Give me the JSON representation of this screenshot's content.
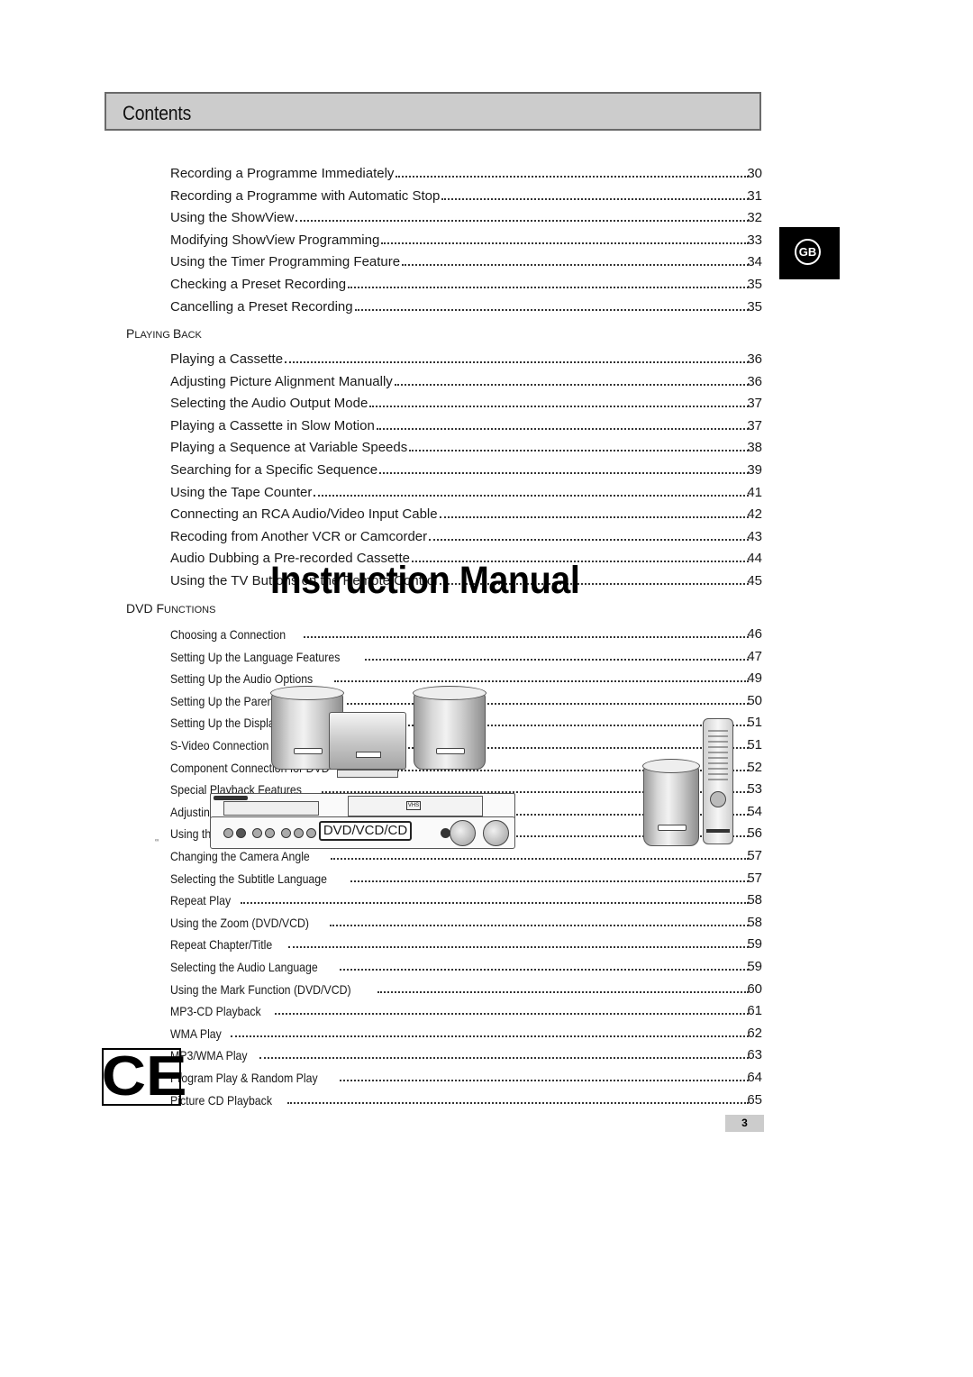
{
  "header": {
    "title": "Contents"
  },
  "language_tab": {
    "label": "GB"
  },
  "watermark": "Instruction Manual",
  "sections": [
    {
      "title": null,
      "items": [
        {
          "label": "Recording a Programme Immediately",
          "page": "30"
        },
        {
          "label": "Recording a Programme with Automatic Stop",
          "page": "31"
        },
        {
          "label": "Using the ShowView",
          "page": "32"
        },
        {
          "label": "Modifying ShowView Programming",
          "page": "33"
        },
        {
          "label": "Using the Timer Programming Feature",
          "page": "34"
        },
        {
          "label": "Checking a Preset Recording",
          "page": "35"
        },
        {
          "label": "Cancelling a Preset Recording",
          "page": "35"
        }
      ]
    },
    {
      "title": {
        "first_big": "P",
        "first_small": "LAYING ",
        "second_big": "B",
        "second_small": "ACK"
      },
      "items": [
        {
          "label": "Playing a Cassette",
          "page": "36"
        },
        {
          "label": "Adjusting Picture Alignment Manually",
          "page": "36"
        },
        {
          "label": "Selecting the Audio Output Mode",
          "page": "37"
        },
        {
          "label": "Playing a Cassette in Slow Motion",
          "page": "37"
        },
        {
          "label": "Playing a Sequence at Variable Speeds",
          "page": "38"
        },
        {
          "label": "Searching for a Specific Sequence",
          "page": "39"
        },
        {
          "label": "Using the Tape Counter",
          "page": "41"
        },
        {
          "label": "Connecting an RCA Audio/Video Input Cable",
          "page": "42"
        },
        {
          "label": "Recoding from Another VCR or Camcorder",
          "page": "43"
        },
        {
          "label": "Audio Dubbing a Pre-recorded Cassette",
          "page": "44"
        },
        {
          "label": "Using the TV Buttons on the Remote Control",
          "page": "45"
        }
      ]
    },
    {
      "title": {
        "first_big": "DVD F",
        "first_small": "UNCTIONS",
        "second_big": "",
        "second_small": ""
      },
      "items": [
        {
          "label": "Choosing a Connection",
          "page": "46"
        },
        {
          "label": "Setting Up the Language Features",
          "page": "47"
        },
        {
          "label": "Setting Up the Audio Options",
          "page": "49"
        },
        {
          "label": "Setting Up the Parental Control",
          "page": "50"
        },
        {
          "label": "Setting Up the Display Options",
          "page": "51"
        },
        {
          "label": "S-Video Connection (DVD/VCR)",
          "page": "51"
        },
        {
          "label": "Component Connection for DVD",
          "page": "52"
        },
        {
          "label": "Special Playback Features",
          "page": "53"
        },
        {
          "label": "Adjusting the Aspect Ratio (EZ VIEW)",
          "page": "54"
        },
        {
          "label": "Using the Display Function (DVD/VCD/CD)",
          "page": "56"
        },
        {
          "label": "Changing the Camera Angle",
          "page": "57"
        },
        {
          "label": "Selecting the Subtitle Language",
          "page": "57"
        },
        {
          "label": "Repeat Play",
          "page": "58"
        },
        {
          "label": "Using the Zoom (DVD/VCD)",
          "page": "58"
        },
        {
          "label": "Repeat Chapter/Title",
          "page": "59"
        },
        {
          "label": "Selecting the Audio Language",
          "page": "59"
        },
        {
          "label": "Using the Mark Function (DVD/VCD)",
          "page": "60"
        },
        {
          "label": "MP3-CD Playback",
          "page": "61"
        },
        {
          "label": "WMA Play",
          "page": "62"
        },
        {
          "label": "MP3/WMA Play",
          "page": "63"
        },
        {
          "label": "Program Play & Random Play",
          "page": "64"
        },
        {
          "label": "Picture CD Playback",
          "page": "65"
        }
      ]
    }
  ],
  "illustration": {
    "display_text": "DVD/VCD/CD",
    "vhs_badge": "VHS"
  },
  "ce_mark": "CE",
  "small_mark": "∞",
  "page_number": "3"
}
